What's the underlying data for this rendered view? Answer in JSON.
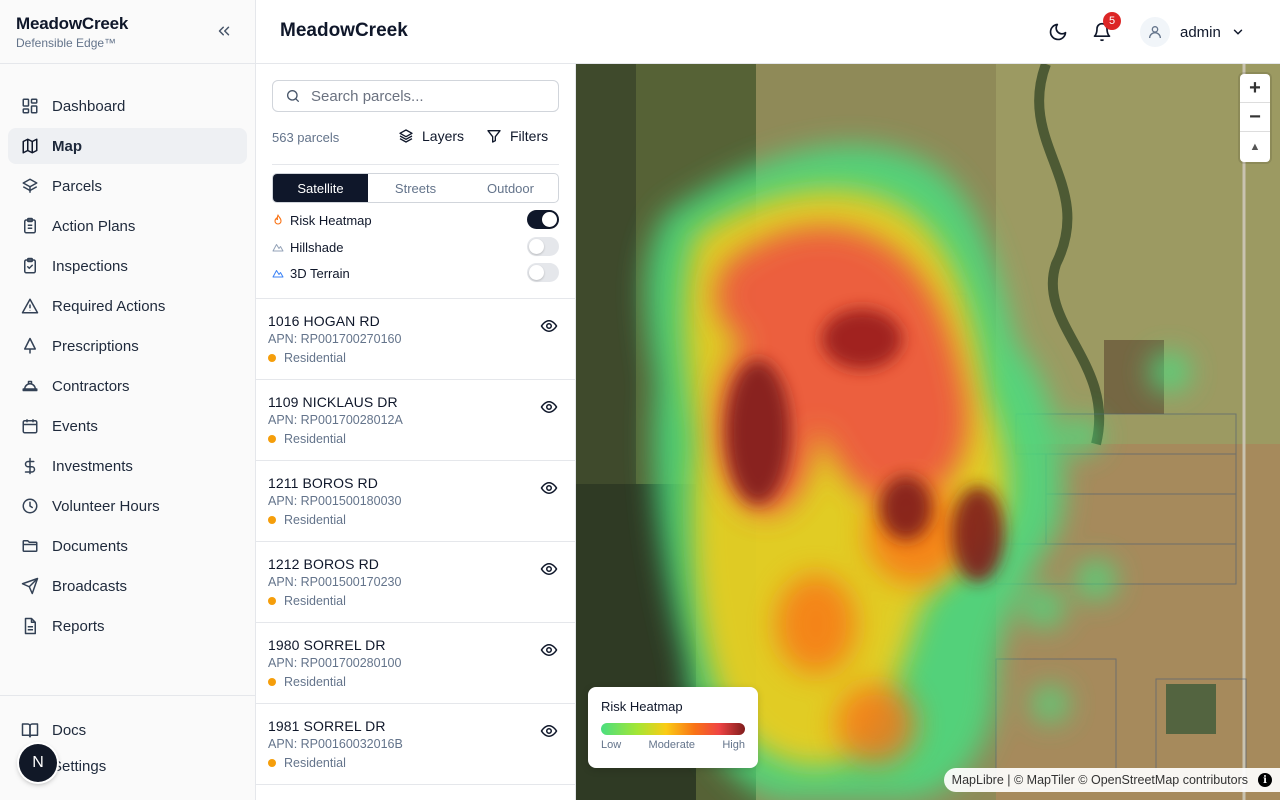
{
  "brand": {
    "name": "MeadowCreek",
    "subtitle": "Defensible Edge™"
  },
  "nav": [
    {
      "label": "Dashboard",
      "icon": "dashboard-icon",
      "active": false
    },
    {
      "label": "Map",
      "icon": "map-icon",
      "active": true
    },
    {
      "label": "Parcels",
      "icon": "parcels-icon",
      "active": false
    },
    {
      "label": "Action Plans",
      "icon": "clipboard-list-icon",
      "active": false
    },
    {
      "label": "Inspections",
      "icon": "clipboard-check-icon",
      "active": false
    },
    {
      "label": "Required Actions",
      "icon": "warning-icon",
      "active": false
    },
    {
      "label": "Prescriptions",
      "icon": "tree-icon",
      "active": false
    },
    {
      "label": "Contractors",
      "icon": "hard-hat-icon",
      "active": false
    },
    {
      "label": "Events",
      "icon": "calendar-icon",
      "active": false
    },
    {
      "label": "Investments",
      "icon": "dollar-icon",
      "active": false
    },
    {
      "label": "Volunteer Hours",
      "icon": "clock-icon",
      "active": false
    },
    {
      "label": "Documents",
      "icon": "folder-icon",
      "active": false
    },
    {
      "label": "Broadcasts",
      "icon": "send-icon",
      "active": false
    },
    {
      "label": "Reports",
      "icon": "report-icon",
      "active": false
    }
  ],
  "nav_bottom": {
    "docs": "Docs",
    "settings": "Settings"
  },
  "avatar_letter": "N",
  "header": {
    "title": "MeadowCreek",
    "notifications": "5",
    "user": "admin"
  },
  "panel": {
    "search_placeholder": "Search parcels...",
    "count": "563 parcels",
    "layers": "Layers",
    "filters": "Filters",
    "basemaps": [
      "Satellite",
      "Streets",
      "Outdoor"
    ],
    "selected_basemap": "Satellite",
    "overlays": [
      {
        "label": "Risk Heatmap",
        "on": true,
        "icon": "flame-icon",
        "color": "#f97316"
      },
      {
        "label": "Hillshade",
        "on": false,
        "icon": "mountain-icon",
        "color": "#94a3b8"
      },
      {
        "label": "3D Terrain",
        "on": false,
        "icon": "mountain-icon",
        "color": "#3b82f6"
      }
    ],
    "parcels": [
      {
        "address": "1016 HOGAN RD",
        "apn": "APN: RP001700270160",
        "type": "Residential"
      },
      {
        "address": "1109 NICKLAUS DR",
        "apn": "APN: RP00170028012A",
        "type": "Residential"
      },
      {
        "address": "1211 BOROS RD",
        "apn": "APN: RP001500180030",
        "type": "Residential"
      },
      {
        "address": "1212 BOROS RD",
        "apn": "APN: RP001500170230",
        "type": "Residential"
      },
      {
        "address": "1980 SORREL DR",
        "apn": "APN: RP001700280100",
        "type": "Residential"
      },
      {
        "address": "1981 SORREL DR",
        "apn": "APN: RP00160032016B",
        "type": "Residential"
      }
    ]
  },
  "map": {
    "legend": {
      "title": "Risk Heatmap",
      "low": "Low",
      "moderate": "Moderate",
      "high": "High"
    },
    "attribution": "MapLibre | © MapTiler © OpenStreetMap contributors",
    "zoom_in": "+",
    "zoom_out": "−",
    "compass": "▲"
  }
}
